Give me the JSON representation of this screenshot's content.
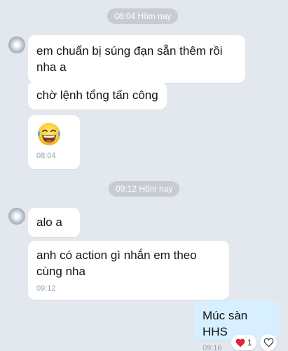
{
  "dividers": [
    {
      "label": "08:04 Hôm nay"
    },
    {
      "label": "09:12 Hôm nay"
    }
  ],
  "messages": {
    "m1": {
      "text": "em chuẩn bị súng đạn sẵn thêm rồi nha a"
    },
    "m2": {
      "text": "chờ lệnh tổng tấn công"
    },
    "m3": {
      "emoji": "laughing-tears-emoji",
      "time": "08:04"
    },
    "m4": {
      "text": "alo a"
    },
    "m5": {
      "text": "anh có action gì nhắn em theo cùng nha",
      "time": "09:12"
    },
    "m6": {
      "text": "Múc sàn HHS",
      "time": "09:16"
    }
  },
  "reaction": {
    "icon": "red-heart-icon",
    "count": "1"
  },
  "react_button": {
    "icon": "heart-outline-icon"
  },
  "colors": {
    "background": "#e3e8ee",
    "incoming_bubble": "#ffffff",
    "outgoing_bubble": "#d7efff",
    "divider_pill": "#c7ccd3",
    "heart_red": "#e0243c"
  }
}
